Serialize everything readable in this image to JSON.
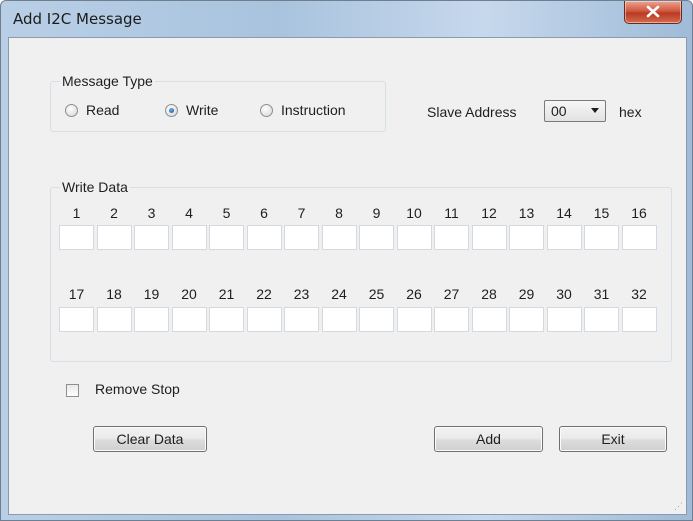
{
  "window": {
    "title": "Add I2C Message"
  },
  "message_type": {
    "label": "Message Type",
    "options": [
      {
        "label": "Read",
        "checked": false
      },
      {
        "label": "Write",
        "checked": true
      },
      {
        "label": "Instruction",
        "checked": false
      }
    ]
  },
  "slave_address": {
    "label": "Slave Address",
    "value": "00",
    "unit": "hex"
  },
  "write_data": {
    "label": "Write Data",
    "indices": [
      "1",
      "2",
      "3",
      "4",
      "5",
      "6",
      "7",
      "8",
      "9",
      "10",
      "11",
      "12",
      "13",
      "14",
      "15",
      "16",
      "17",
      "18",
      "19",
      "20",
      "21",
      "22",
      "23",
      "24",
      "25",
      "26",
      "27",
      "28",
      "29",
      "30",
      "31",
      "32"
    ],
    "values": [
      "",
      "",
      "",
      "",
      "",
      "",
      "",
      "",
      "",
      "",
      "",
      "",
      "",
      "",
      "",
      "",
      "",
      "",
      "",
      "",
      "",
      "",
      "",
      "",
      "",
      "",
      "",
      "",
      "",
      "",
      "",
      ""
    ]
  },
  "remove_stop": {
    "label": "Remove Stop",
    "checked": false
  },
  "buttons": {
    "clear": "Clear Data",
    "add": "Add",
    "exit": "Exit"
  },
  "icons": {
    "close": "close-icon",
    "resize": "resize-grip-icon"
  }
}
